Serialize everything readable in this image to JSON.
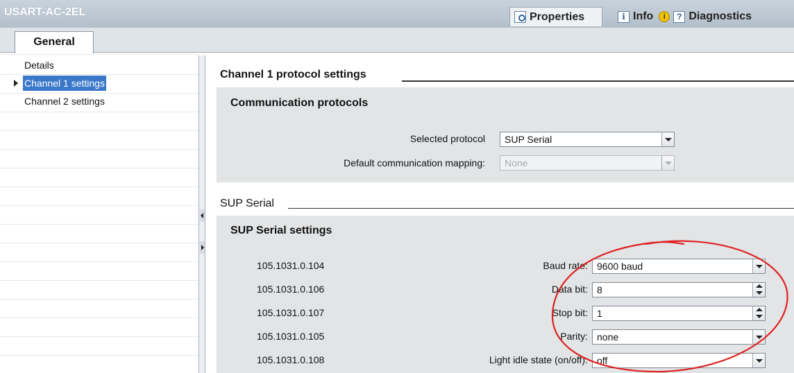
{
  "window": {
    "title": "USART-AC-2EL"
  },
  "inspector_tabs": {
    "properties": "Properties",
    "info": "Info",
    "diagnostics": "Diagnostics"
  },
  "tab_general": "General",
  "nav": {
    "items": [
      {
        "label": "Details",
        "selected": false
      },
      {
        "label": "Channel 1 settings",
        "selected": true
      },
      {
        "label": "Channel 2 settings",
        "selected": false
      }
    ]
  },
  "main": {
    "section_title": "Channel 1 protocol settings",
    "comm_panel": {
      "title": "Communication protocols",
      "selected_protocol_label": "Selected protocol",
      "selected_protocol_value": "SUP Serial",
      "default_mapping_label": "Default communication mapping:",
      "default_mapping_value": "None"
    },
    "sup_section_title": "SUP Serial",
    "sup_panel": {
      "title": "SUP Serial settings",
      "rows": [
        {
          "address": "105.1031.0.104",
          "label": "Baud rate:",
          "value": "9600 baud",
          "control": "dropdown"
        },
        {
          "address": "105.1031.0.106",
          "label": "Data bit:",
          "value": "8",
          "control": "spinner"
        },
        {
          "address": "105.1031.0.107",
          "label": "Stop bit:",
          "value": "1",
          "control": "spinner"
        },
        {
          "address": "105.1031.0.105",
          "label": "Parity:",
          "value": "none",
          "control": "dropdown"
        },
        {
          "address": "105.1031.0.108",
          "label": "Light idle state (on/off):",
          "value": "off",
          "control": "dropdown"
        }
      ]
    }
  },
  "colors": {
    "selection": "#3a78c9",
    "annotation": "#e02020",
    "panel": "#e2e4e6"
  }
}
